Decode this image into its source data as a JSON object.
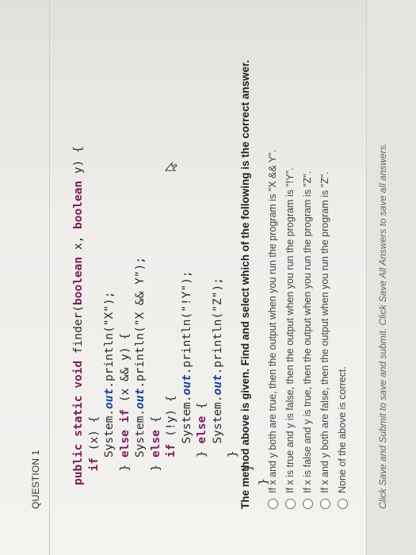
{
  "question": {
    "title": "QUESTION 1",
    "code_lines": [
      "public static void finder(boolean x, boolean y) {",
      "  if (x) {",
      "    System.out.println(\"X\");",
      "  } else if (x && y) {",
      "    System.out.println(\"X && Y\");",
      "  } else {",
      "    if (!y) {",
      "      System.out.println(\"!Y\");",
      "    } else {",
      "      System.out.println(\"Z\");",
      "    }",
      "  }",
      "}"
    ],
    "prompt": "The method above is given. Find and select which of the following is the correct answer.",
    "options": [
      {
        "label": "If x and y both are true, then the output when you run the program is \"X && Y\"."
      },
      {
        "label": "If x is true and y is false, then the output when you run the program is \"!Y\"."
      },
      {
        "label": "If x is false and y is true, then the output when you run the program is \"Z\"."
      },
      {
        "label": "If x and y both are false, then the output when you run the program is \"Z\"."
      },
      {
        "label": "None of the above is correct."
      }
    ]
  },
  "footer": {
    "text": "Click Save and Submit to save and submit. Click Save All Answers to save all answers."
  },
  "colors": {
    "keyword": "#7d1a5c",
    "method_call": "#1f3f9a",
    "background": "#f3f2ef"
  },
  "icons": {
    "cursor": "mouse-pointer-icon"
  }
}
